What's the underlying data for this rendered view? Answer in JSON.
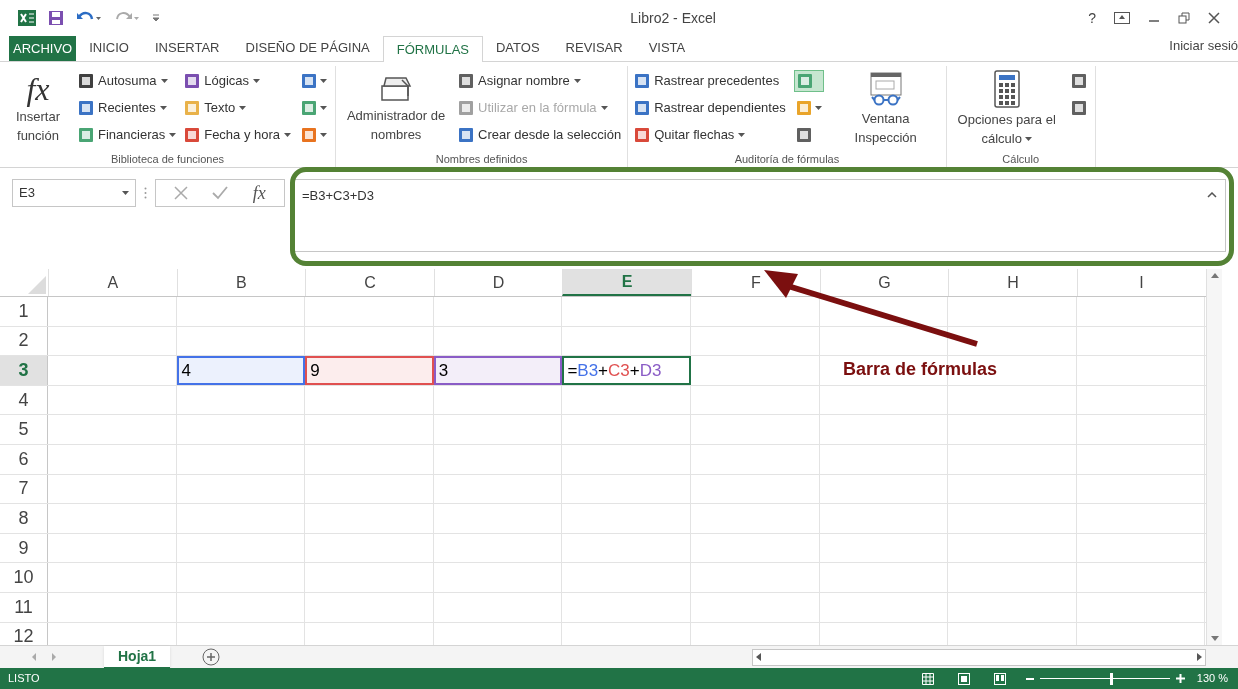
{
  "title_bar": {
    "title": "Libro2 - Excel",
    "help": "?"
  },
  "ribbon_tabs": [
    {
      "label": "ARCHIVO",
      "kind": "file",
      "selected": false
    },
    {
      "label": "INICIO",
      "kind": "tab",
      "selected": false
    },
    {
      "label": "INSERTAR",
      "kind": "tab",
      "selected": false
    },
    {
      "label": "DISEÑO DE PÁGINA",
      "kind": "tab",
      "selected": false
    },
    {
      "label": "FÓRMULAS",
      "kind": "tab",
      "selected": true
    },
    {
      "label": "DATOS",
      "kind": "tab",
      "selected": false
    },
    {
      "label": "REVISAR",
      "kind": "tab",
      "selected": false
    },
    {
      "label": "VISTA",
      "kind": "tab",
      "selected": false
    }
  ],
  "sign_in": "Iniciar sesió",
  "ribbon_groups": [
    {
      "title": "Biblioteca de funciones",
      "parts": [
        {
          "kind": "large",
          "icon_text": "fx",
          "label": "Insertar función",
          "dropdown": false
        },
        {
          "kind": "stack",
          "items": [
            {
              "label": "Autosuma",
              "color": "#404040",
              "dropdown": true,
              "disabled": false
            },
            {
              "label": "Recientes",
              "color": "#3b73c4",
              "dropdown": true,
              "disabled": false
            },
            {
              "label": "Financieras",
              "color": "#4aa574",
              "dropdown": true,
              "disabled": false
            }
          ]
        },
        {
          "kind": "stack",
          "items": [
            {
              "label": "Lógicas",
              "color": "#7b4fb0",
              "dropdown": true,
              "disabled": false
            },
            {
              "label": "Texto",
              "color": "#e9b24a",
              "dropdown": true,
              "disabled": false
            },
            {
              "label": "Fecha y hora",
              "color": "#d9493a",
              "dropdown": true,
              "disabled": false
            }
          ]
        },
        {
          "kind": "icon_stack",
          "items": [
            {
              "color": "#3b73c4",
              "dropdown": true,
              "on": false
            },
            {
              "color": "#4aa574",
              "dropdown": true,
              "on": false
            },
            {
              "color": "#e8731f",
              "dropdown": true,
              "on": false
            }
          ]
        }
      ]
    },
    {
      "title": "Nombres definidos",
      "parts": [
        {
          "kind": "large",
          "label": "Administrador de nombres",
          "dropdown": false
        },
        {
          "kind": "stack",
          "items": [
            {
              "label": "Asignar nombre",
              "color": "#606060",
              "dropdown": true,
              "disabled": false
            },
            {
              "label": "Utilizar en la fórmula",
              "color": "#a0a0a0",
              "dropdown": true,
              "disabled": true
            },
            {
              "label": "Crear desde la selección",
              "color": "#3b73c4",
              "dropdown": false,
              "disabled": false
            }
          ]
        }
      ]
    },
    {
      "title": "Auditoría de fórmulas",
      "parts": [
        {
          "kind": "stack",
          "items": [
            {
              "label": "Rastrear precedentes",
              "color": "#3b73c4",
              "dropdown": false,
              "disabled": false
            },
            {
              "label": "Rastrear dependientes",
              "color": "#3b73c4",
              "dropdown": false,
              "disabled": false
            },
            {
              "label": "Quitar flechas",
              "color": "#d9493a",
              "dropdown": true,
              "disabled": false
            }
          ]
        },
        {
          "kind": "icon_stack",
          "items": [
            {
              "color": "#4aa574",
              "dropdown": false,
              "on": true
            },
            {
              "color": "#e9a42a",
              "dropdown": true,
              "on": false
            },
            {
              "color": "#606060",
              "dropdown": false,
              "on": false
            }
          ]
        },
        {
          "kind": "large",
          "label": "Ventana Inspección",
          "dropdown": false
        }
      ]
    },
    {
      "title": "Cálculo",
      "parts": [
        {
          "kind": "large",
          "label": "Opciones para el cálculo",
          "dropdown": true
        },
        {
          "kind": "icon_stack",
          "items": [
            {
              "color": "#606060",
              "dropdown": false,
              "on": false
            },
            {
              "color": "#606060",
              "dropdown": false,
              "on": false
            }
          ]
        }
      ]
    }
  ],
  "formula_bar": {
    "name_box": "E3",
    "function_label": "fx",
    "formula": "=B3+C3+D3"
  },
  "grid": {
    "columns": [
      {
        "label": "A",
        "selected": false
      },
      {
        "label": "B",
        "selected": false
      },
      {
        "label": "C",
        "selected": false
      },
      {
        "label": "D",
        "selected": false
      },
      {
        "label": "E",
        "selected": true
      },
      {
        "label": "F",
        "selected": false
      },
      {
        "label": "G",
        "selected": false
      },
      {
        "label": "H",
        "selected": false
      },
      {
        "label": "I",
        "selected": false
      }
    ],
    "rows": [
      {
        "label": "1",
        "selected": false,
        "cells": []
      },
      {
        "label": "2",
        "selected": false,
        "cells": []
      },
      {
        "label": "3",
        "selected": true,
        "cells": [
          {},
          {
            "value": "4",
            "color": "#4472e8"
          },
          {
            "value": "9",
            "color": "#e05050"
          },
          {
            "value": "3",
            "color": "#8a5cc6"
          },
          {
            "active": true,
            "parts": [
              {
                "text": "=",
                "color": "#000000"
              },
              {
                "text": "B3",
                "color": "#4472e8"
              },
              {
                "text": "+",
                "color": "#000000"
              },
              {
                "text": "C3",
                "color": "#e05050"
              },
              {
                "text": "+",
                "color": "#000000"
              },
              {
                "text": "D3",
                "color": "#8a5cc6"
              }
            ]
          }
        ]
      },
      {
        "label": "4",
        "selected": false,
        "cells": []
      },
      {
        "label": "5",
        "selected": false,
        "cells": []
      },
      {
        "label": "6",
        "selected": false,
        "cells": []
      },
      {
        "label": "7",
        "selected": false,
        "cells": []
      },
      {
        "label": "8",
        "selected": false,
        "cells": []
      },
      {
        "label": "9",
        "selected": false,
        "cells": []
      },
      {
        "label": "10",
        "selected": false,
        "cells": []
      },
      {
        "label": "11",
        "selected": false,
        "cells": []
      },
      {
        "label": "12",
        "selected": false,
        "cells": []
      }
    ]
  },
  "annotation": {
    "label": "Barra de fórmulas"
  },
  "sheet_tabs": [
    {
      "label": "Hoja1",
      "selected": true
    }
  ],
  "status_bar": {
    "status": "LISTO",
    "zoom": {
      "level": 0.54,
      "reading": "130 %"
    }
  }
}
